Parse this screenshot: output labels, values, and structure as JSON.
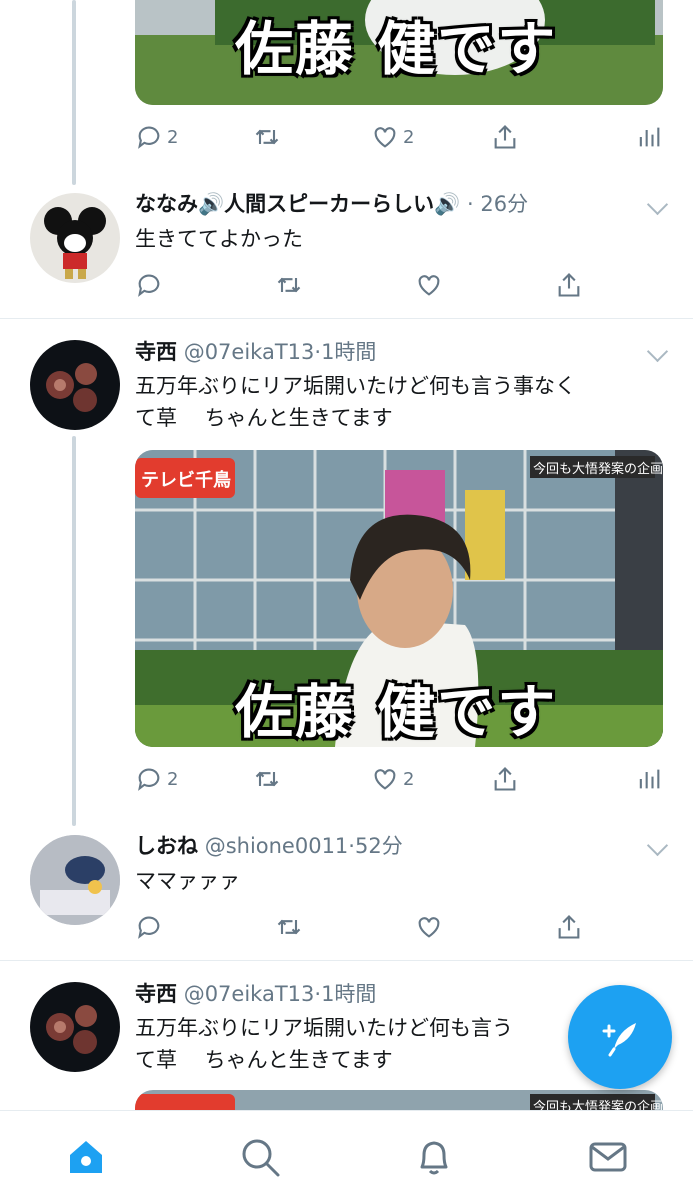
{
  "tweets": [
    {
      "actions": {
        "reply_count": "2",
        "like_count": "2"
      },
      "media_caption": "佐藤 健です"
    },
    {
      "name": "ななみ🔊人間スピーカーらしい🔊",
      "handle": "",
      "time": "26分",
      "text": "生きててよかった"
    },
    {
      "name": "寺西",
      "handle": "@07eikaT13",
      "time": "1時間",
      "text": "五万年ぶりにリア垢開いたけど何も言う事なく\nて草 　ちゃんと生きてます",
      "media_logo": "テレビ千鳥",
      "media_banner": "今回も大悟発案の企画",
      "media_caption": "佐藤 健です",
      "actions": {
        "reply_count": "2",
        "like_count": "2"
      }
    },
    {
      "name": "しおね",
      "handle": "@shione0011",
      "time": "52分",
      "text": "ママァァァ"
    },
    {
      "name": "寺西",
      "handle": "@07eikaT13",
      "time": "1時間",
      "text": "五万年ぶりにリア垢開いたけど何も言う\nて草 　ちゃんと生きてます",
      "media_banner": "今回も大悟発案の企画"
    }
  ],
  "separator": "·",
  "colors": {
    "accent": "#1da1f2",
    "muted": "#657786",
    "divider": "#e6ecf0"
  }
}
